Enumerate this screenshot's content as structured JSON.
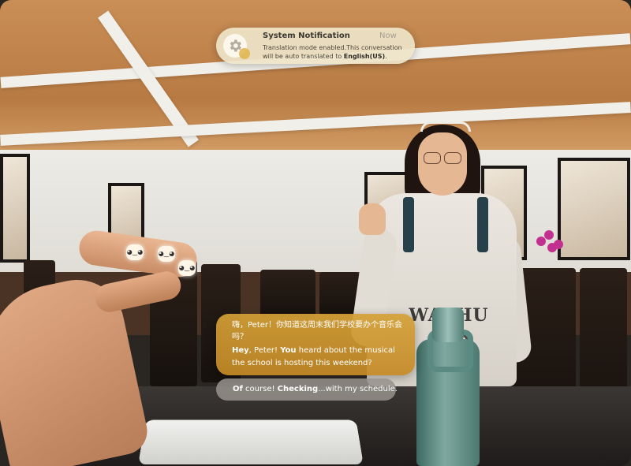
{
  "notification": {
    "title": "System Notification",
    "time": "Now",
    "body_prefix": "Translation mode enabled.This conversation will be auto translated to ",
    "body_language": "English(US)",
    "body_suffix": ".",
    "icon": "gear-icon"
  },
  "translation": {
    "original_text": "嗨，Peter！你知道这周末我们学校要办个音乐会吗？",
    "translated_parts": [
      {
        "text": "Hey",
        "bold": true
      },
      {
        "text": ", ",
        "bold": false
      },
      {
        "text": "Peter",
        "bold": false
      },
      {
        "text": "! ",
        "bold": false
      },
      {
        "text": "You",
        "bold": true
      },
      {
        "text": " heard about the musical the school is hosting this weekend?",
        "bold": false
      }
    ]
  },
  "reply": {
    "parts": [
      {
        "text": "Of",
        "bold": true
      },
      {
        "text": " course! ",
        "bold": false
      },
      {
        "text": "Checking",
        "bold": true
      },
      {
        "text": "...with my schedule.",
        "bold": false
      }
    ]
  },
  "scene": {
    "sweater_print": "WASHU"
  },
  "colors": {
    "accent": "#d4a037",
    "notification_bg": "#eee4c8",
    "reply_bg": "#96928c"
  }
}
